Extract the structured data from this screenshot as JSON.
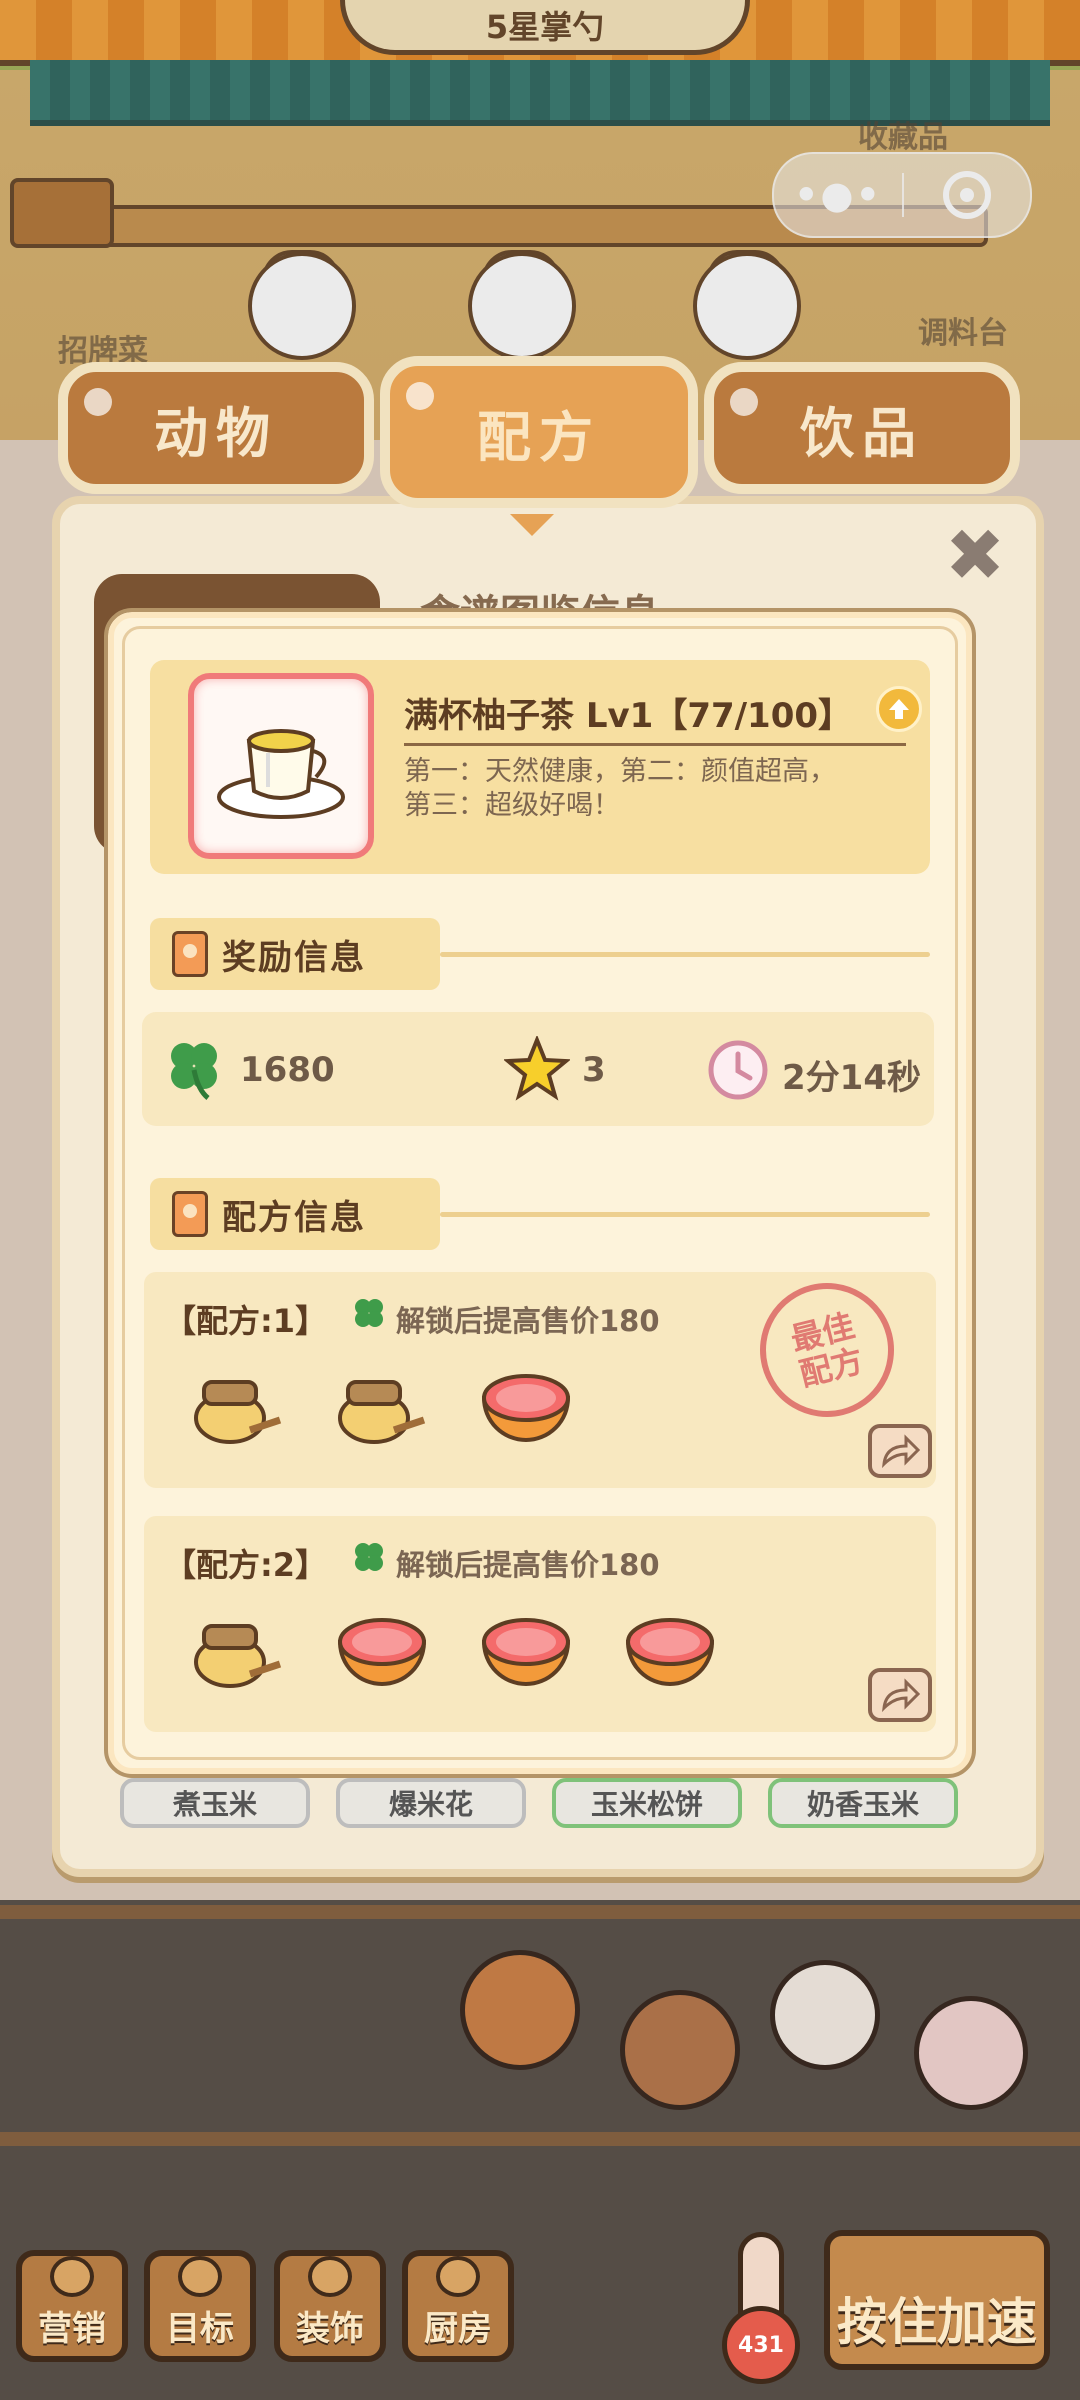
{
  "scene": {
    "roof_sign": "5星掌勺",
    "side_labels": {
      "signature_dish": "招牌菜",
      "collection": "收藏品",
      "seasoning": "调料台"
    }
  },
  "tabs": [
    {
      "label": "动物",
      "active": false
    },
    {
      "label": "配方",
      "active": true
    },
    {
      "label": "饮品",
      "active": false
    }
  ],
  "background_panel": {
    "title_partial": "食谱图鉴信息",
    "chips": [
      "煮玉米",
      "爆米花",
      "玉米松饼",
      "奶香玉米"
    ]
  },
  "item": {
    "title": "满杯柚子茶 Lv1【77/100】",
    "description": "第一：天然健康，第二：颜值超高，第三：超级好喝！",
    "icon": "teacup-icon"
  },
  "reward_section": {
    "title": "奖励信息",
    "clover": "1680",
    "stars": "3",
    "time": "2分14秒"
  },
  "recipe_section": {
    "title": "配方信息",
    "recipes": [
      {
        "label": "【配方:1】",
        "bonus": "解锁后提高售价180",
        "ingredients": [
          "honey-jar-icon",
          "honey-jar-icon",
          "grapefruit-icon"
        ],
        "best": true
      },
      {
        "label": "【配方:2】",
        "bonus": "解锁后提高售价180",
        "ingredients": [
          "honey-jar-icon",
          "grapefruit-icon",
          "grapefruit-icon",
          "grapefruit-icon"
        ],
        "best": false
      }
    ],
    "best_stamp": [
      "最佳",
      "配方"
    ]
  },
  "bottom_bar": {
    "buttons": [
      "营销",
      "目标",
      "装饰",
      "厨房"
    ],
    "speed": "按住加速",
    "thermometer": "431"
  },
  "colors": {
    "accent": "#e6a255",
    "dialog_bg": "#fdf3db",
    "stamp": "#e07a72"
  }
}
